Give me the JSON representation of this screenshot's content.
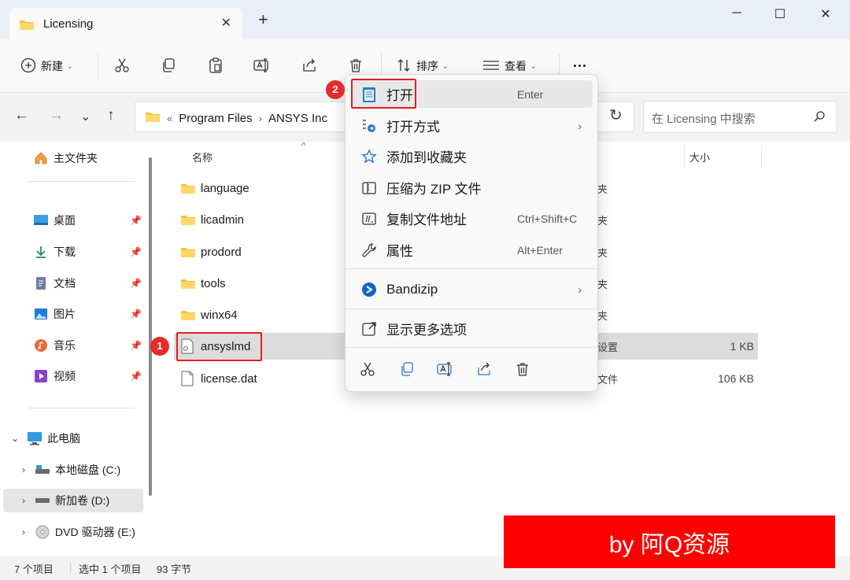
{
  "window": {
    "tab_title": "Licensing",
    "new_tab": "+",
    "minimize": "─",
    "maximize": "☐",
    "close": "✕"
  },
  "toolbar": {
    "new_label": "新建",
    "sort_label": "排序",
    "view_label": "查看",
    "more_label": "···"
  },
  "address": {
    "overflow": "«",
    "crumbs": [
      "Program Files",
      "ANSYS Inc"
    ],
    "search_placeholder": "在 Licensing 中搜索"
  },
  "sidebar": {
    "home": "主文件夹",
    "quick": [
      {
        "label": "桌面",
        "icon": "desktop-icon"
      },
      {
        "label": "下载",
        "icon": "download-icon"
      },
      {
        "label": "文档",
        "icon": "document-icon"
      },
      {
        "label": "图片",
        "icon": "pictures-icon"
      },
      {
        "label": "音乐",
        "icon": "music-icon"
      },
      {
        "label": "视频",
        "icon": "video-icon"
      }
    ],
    "this_pc": "此电脑",
    "drives": [
      {
        "label": "本地磁盘 (C:)"
      },
      {
        "label": "新加卷 (D:)"
      },
      {
        "label": "DVD 驱动器 (E:)"
      }
    ]
  },
  "columns": {
    "name": "名称",
    "size": "大小"
  },
  "files": [
    {
      "name": "language",
      "type": "folder",
      "extra": "夹",
      "size": ""
    },
    {
      "name": "licadmin",
      "type": "folder",
      "extra": "夹",
      "size": ""
    },
    {
      "name": "prodord",
      "type": "folder",
      "extra": "夹",
      "size": ""
    },
    {
      "name": "tools",
      "type": "folder",
      "extra": "夹",
      "size": ""
    },
    {
      "name": "winx64",
      "type": "folder",
      "extra": "夹",
      "size": ""
    },
    {
      "name": "ansyslmd",
      "type": "settings",
      "extra": "设置",
      "size": "1 KB"
    },
    {
      "name": "license.dat",
      "type": "file",
      "extra": "文件",
      "size": "106 KB"
    }
  ],
  "context_menu": {
    "items": [
      {
        "label": "打开",
        "shortcut": "Enter",
        "icon": "notepad-icon"
      },
      {
        "label": "打开方式",
        "shortcut": "",
        "icon": "open-with-icon"
      },
      {
        "label": "添加到收藏夹",
        "shortcut": "",
        "icon": "star-icon"
      },
      {
        "label": "压缩为 ZIP 文件",
        "shortcut": "",
        "icon": "zip-icon"
      },
      {
        "label": "复制文件地址",
        "shortcut": "Ctrl+Shift+C",
        "icon": "copy-path-icon"
      },
      {
        "label": "属性",
        "shortcut": "Alt+Enter",
        "icon": "wrench-icon"
      },
      {
        "label": "Bandizip",
        "shortcut": "",
        "icon": "bandizip-icon"
      },
      {
        "label": "显示更多选项",
        "shortcut": "",
        "icon": "more-options-icon"
      }
    ]
  },
  "annotations": {
    "step1": "1",
    "step2": "2"
  },
  "status": {
    "count": "7 个项目",
    "selected": "选中 1 个项目",
    "bytes": "93 字节"
  },
  "watermark": "by 阿Q资源",
  "colors": {
    "accent": "#0067c0",
    "folder": "#f4c430",
    "highlight_red": "#e02020",
    "watermark_bg": "#ff0000"
  }
}
